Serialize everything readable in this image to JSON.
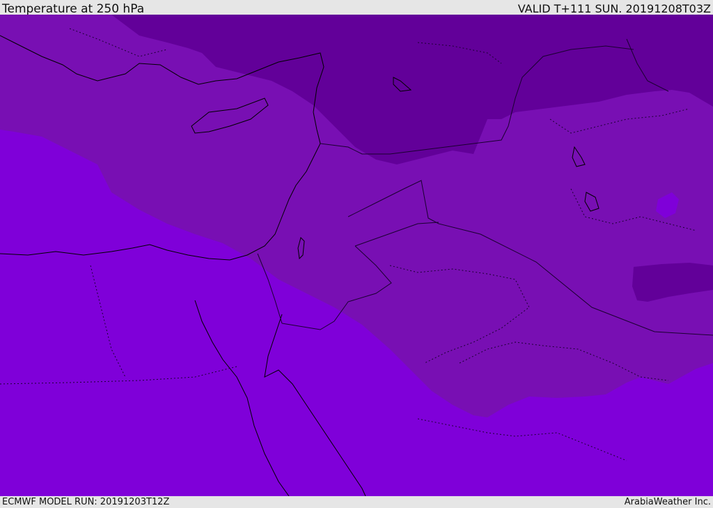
{
  "header": {
    "title": "Temperature at 250 hPa",
    "valid": "VALID T+111 SUN. 20191208T03Z"
  },
  "footer": {
    "model_run": "ECMWF MODEL RUN: 20191203T12Z",
    "credit": "ArabiaWeather Inc."
  },
  "map": {
    "field": "temperature",
    "level_hpa": 250,
    "colors": {
      "coldest": "#620099",
      "cold": "#780fb3",
      "warm": "#7f00d9",
      "coastline": "#000000",
      "borders": "#1a0030"
    }
  }
}
